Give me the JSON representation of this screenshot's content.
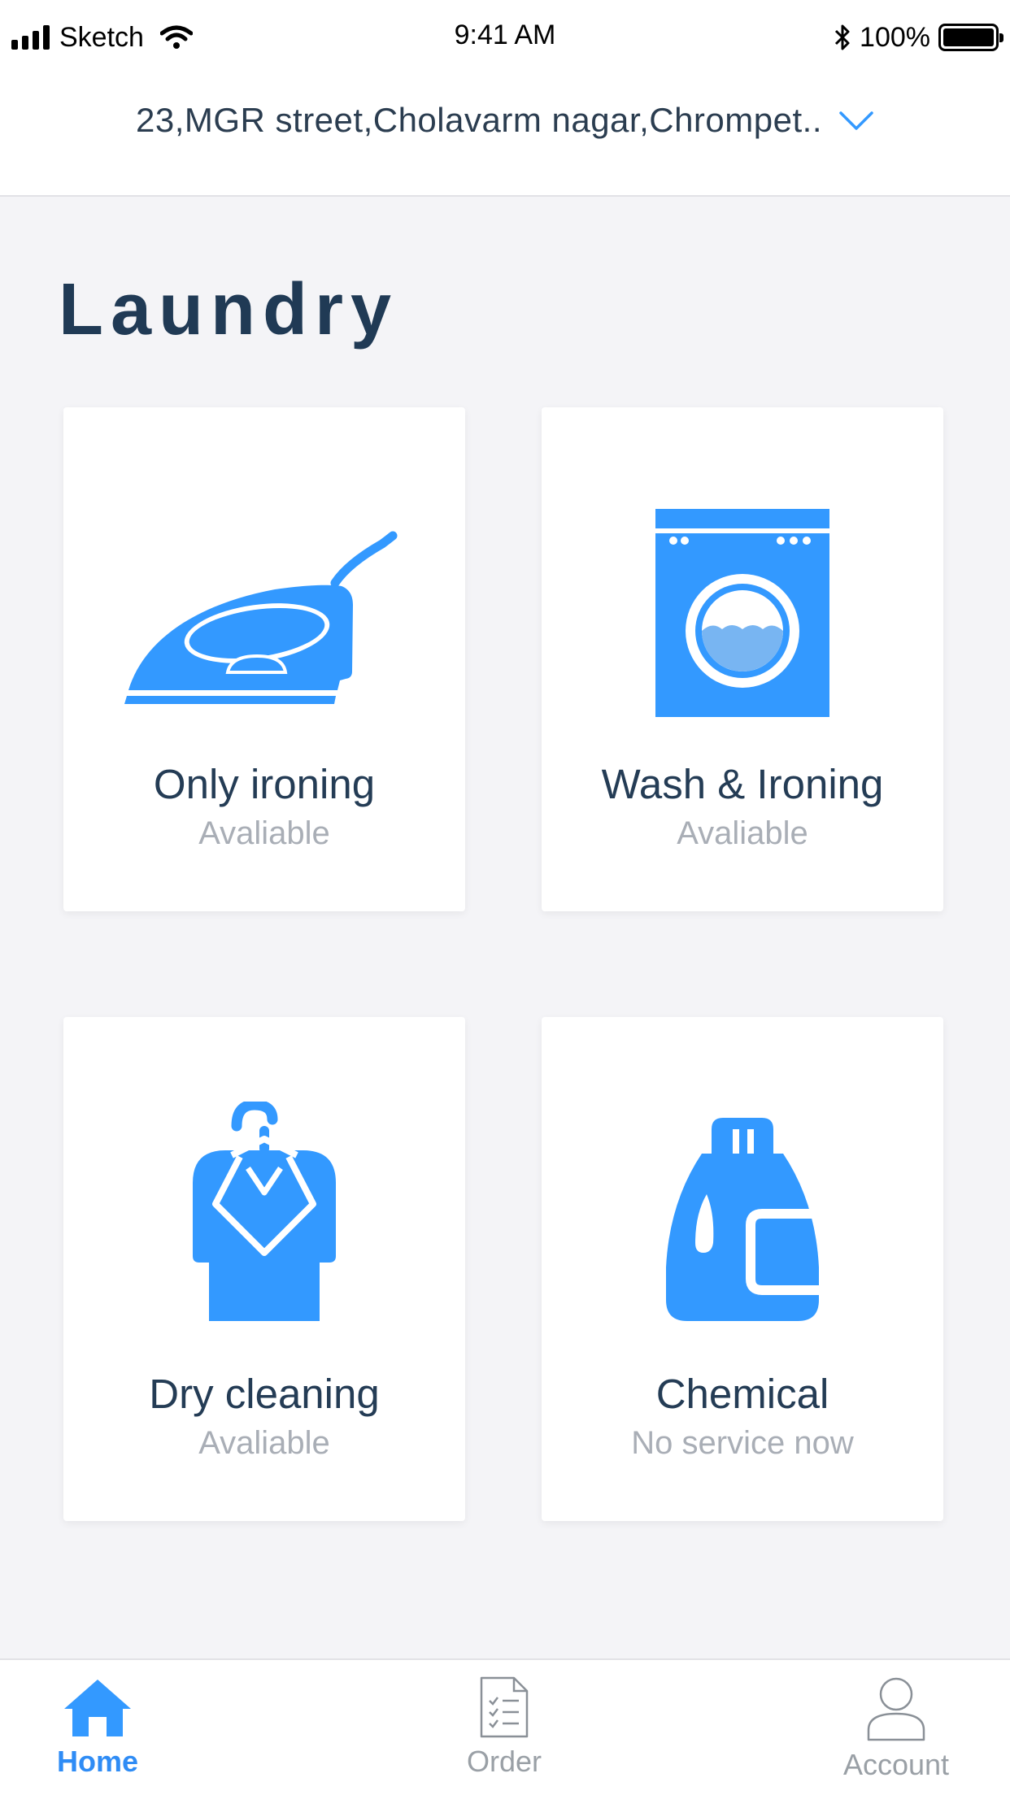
{
  "status_bar": {
    "carrier": "Sketch",
    "time": "9:41 AM",
    "battery": "100%"
  },
  "address": {
    "text": "23,MGR street,Cholavarm nagar,Chrompet.."
  },
  "page": {
    "title": "Laundry"
  },
  "services": [
    {
      "name": "Only ironing",
      "status": "Avaliable",
      "icon": "iron-icon"
    },
    {
      "name": "Wash & Ironing",
      "status": "Avaliable",
      "icon": "washing-machine-icon"
    },
    {
      "name": "Dry cleaning",
      "status": "Avaliable",
      "icon": "dry-cleaning-icon"
    },
    {
      "name": "Chemical",
      "status": "No service now",
      "icon": "detergent-bottle-icon"
    }
  ],
  "tabs": [
    {
      "label": "Home",
      "icon": "home-icon",
      "active": true
    },
    {
      "label": "Order",
      "icon": "order-document-icon",
      "active": false
    },
    {
      "label": "Account",
      "icon": "account-user-icon",
      "active": false
    }
  ],
  "colors": {
    "accent": "#3399ff",
    "title": "#203a55",
    "muted": "#a9aeb6",
    "background": "#f4f4f7"
  }
}
